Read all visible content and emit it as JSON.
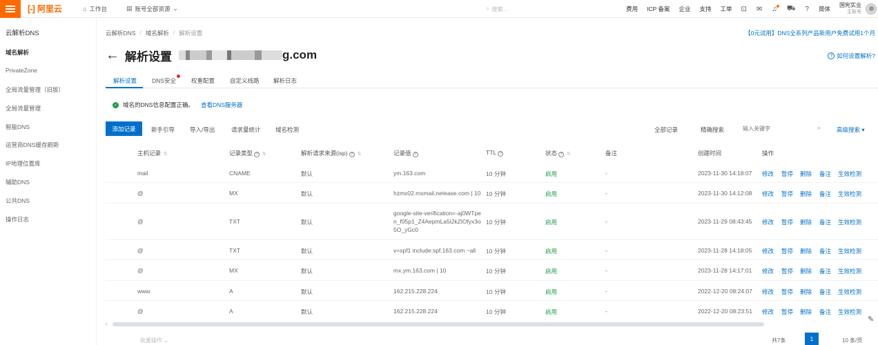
{
  "topbar": {
    "logo_text": "阿里云",
    "home_label": "工作台",
    "resources_label": "账号全部资源",
    "search_placeholder": "搜索...",
    "right_items": [
      "费用",
      "ICP 备案",
      "企业",
      "支持",
      "工单"
    ],
    "lang_label": "简体",
    "account_name": "国宪实业",
    "account_role": "主账号"
  },
  "sidebar": {
    "title": "云解析DNS",
    "items": [
      "域名解析",
      "PrivateZone",
      "全局流量管理（旧版）",
      "全局流量管理",
      "智能DNS",
      "运营商DNS缓存刷新",
      "IP地理位置库",
      "辅助DNS",
      "公共DNS",
      "操作日志"
    ]
  },
  "breadcrumb": [
    "云解析DNS",
    "域名解析",
    "解析设置"
  ],
  "promo": "【0元试用】DNS全系列产品新用户免费试用1个月",
  "page": {
    "title": "解析设置",
    "domain_suffix": "g.com",
    "help": "如何设置解析?"
  },
  "tabs": [
    "解析设置",
    "DNS安全",
    "权重配置",
    "自定义线路",
    "解析日志"
  ],
  "notice": {
    "text": "域名的DNS信息配置正确。",
    "link": "查看DNS服务器"
  },
  "toolbar": {
    "add": "添加记录",
    "buttons": [
      "新手引导",
      "导入/导出",
      "请求量统计",
      "域名检测"
    ],
    "all_records": "全部记录",
    "precise_search": "精确搜索",
    "search_placeholder": "输入关键字",
    "advanced": "高级搜索"
  },
  "columns": [
    "主机记录",
    "记录类型",
    "解析请求来源(isp)",
    "记录值",
    "TTL",
    "状态",
    "备注",
    "创建时间",
    "操作"
  ],
  "rows": [
    {
      "host": "mail",
      "type": "CNAME",
      "isp": "默认",
      "value": "ym.163.com",
      "ttl": "10 分钟",
      "status": "启用",
      "remark": "-",
      "created": "2023-11-30 14:18:07"
    },
    {
      "host": "@",
      "type": "MX",
      "isp": "默认",
      "value": "hzmx02.mxmail.netease.com | 10",
      "ttl": "10 分钟",
      "status": "启用",
      "remark": "-",
      "created": "2023-11-30 14:12:08"
    },
    {
      "host": "@",
      "type": "TXT",
      "isp": "默认",
      "value": "google-site-verification=-aj0WTpen_f05p1_Z4AepmLa5i2kZlOfyx3o5O_yGc0",
      "ttl": "10 分钟",
      "status": "启用",
      "remark": "-",
      "created": "2023-11-29 08:43:45"
    },
    {
      "host": "@",
      "type": "TXT",
      "isp": "默认",
      "value": "v=spf1 include:spf.163.com ~all",
      "ttl": "10 分钟",
      "status": "启用",
      "remark": "-",
      "created": "2023-11-28 14:18:05"
    },
    {
      "host": "@",
      "type": "MX",
      "isp": "默认",
      "value": "mx.ym.163.com | 10",
      "ttl": "10 分钟",
      "status": "启用",
      "remark": "-",
      "created": "2023-11-28 14:17:01"
    },
    {
      "host": "www",
      "type": "A",
      "isp": "默认",
      "value": "162.215.228.224",
      "ttl": "10 分钟",
      "status": "启用",
      "remark": "-",
      "created": "2022-12-20 08:24:07"
    },
    {
      "host": "@",
      "type": "A",
      "isp": "默认",
      "value": "162.215.228.224",
      "ttl": "10 分钟",
      "status": "启用",
      "remark": "-",
      "created": "2022-12-20 08:23:51"
    }
  ],
  "actions": [
    "修改",
    "暂停",
    "删除",
    "备注",
    "生效检测"
  ],
  "pagination": {
    "select_label": "批量操作",
    "total": "共7条",
    "current": "1",
    "page_size": "10 条/页"
  },
  "colors": {
    "accent": "#0070cc",
    "brand": "#ff6a00",
    "status_on": "#1a9c47"
  }
}
